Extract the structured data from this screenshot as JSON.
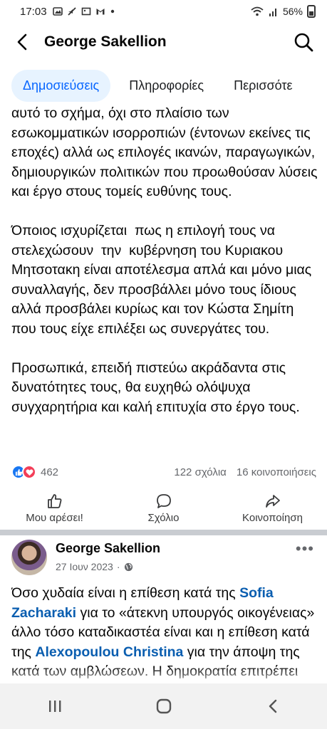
{
  "status_bar": {
    "time": "17:03",
    "battery": "56%",
    "icons": [
      "image-icon",
      "mute-icon",
      "picture-icon",
      "gmail-icon",
      "dot-icon",
      "wifi-icon",
      "signal-icon",
      "battery-icon"
    ]
  },
  "header": {
    "title": "George Sakellion",
    "back_icon": "back-arrow-icon",
    "search_icon": "search-icon"
  },
  "tabs": [
    {
      "label": "Δημοσιεύσεις",
      "active": true
    },
    {
      "label": "Πληροφορίες",
      "active": false
    },
    {
      "label": "Περισσότε",
      "active": false
    }
  ],
  "post1": {
    "paragraphs": [
      "αυτό το σχήμα, όχι στο πλαίσιο των εσωκομματικών ισορροπιών (έντονων εκείνες τις εποχές) αλλά ως επιλογές ικανών, παραγωγικών, δημιουργικών πολιτικών που προωθούσαν λύσεις και έργο στους τομείς ευθύνης τους.",
      "Όποιος ισχυρίζεται  πως η επιλογή τους να στελεχώσουν  την  κυβέρνηση του Κυριακου Μητσοτακη είναι αποτέλεσμα απλά και μόνο μιας συναλλαγής, δεν προσβάλλει μόνο τους ίδιους αλλά προσβάλει κυρίως και τον Κώστα Σημίτη που τους είχε επιλέξει ως συνεργάτες του.",
      "Προσωπικά, επειδή πιστεύω ακράδαντα στις δυνατότητες τους, θα ευχηθώ ολόψυχα συγχαρητήρια και καλή επιτυχία στο έργο τους."
    ],
    "reaction_count": "462",
    "comments": "122 σχόλια",
    "shares": "16 κοινοποιήσεις",
    "actions": {
      "like": "Μου αρέσει!",
      "comment": "Σχόλιο",
      "share": "Κοινοποίηση"
    }
  },
  "post2": {
    "author": "George Sakellion",
    "date": "27 Ιουν 2023",
    "dot": "·",
    "more": "•••",
    "text_parts": {
      "p1": "Όσο χυδαία είναι η επίθεση κατά της ",
      "link1": "Sofia Zacharaki",
      "p2": " για το «άτεκνη υπουργός οικογένειας» άλλο τόσο καταδικαστέα είναι και η επίθεση κατά της ",
      "link2": "Alexopoulou Christina",
      "p3": " για την άποψη της κατά των αμβλώσεων. Η δημοκρατία επιτρέπει ν... Δείτε περισσότερα"
    }
  },
  "colors": {
    "accent": "#0866ff",
    "tab_active_bg": "#e7f3ff",
    "link": "#0a5eb0",
    "like": "#1877f2",
    "love": "#f33e58",
    "divider": "#c9ccd1"
  },
  "nav_bar": {
    "icons": [
      "recent-apps-icon",
      "home-icon",
      "back-icon"
    ]
  }
}
